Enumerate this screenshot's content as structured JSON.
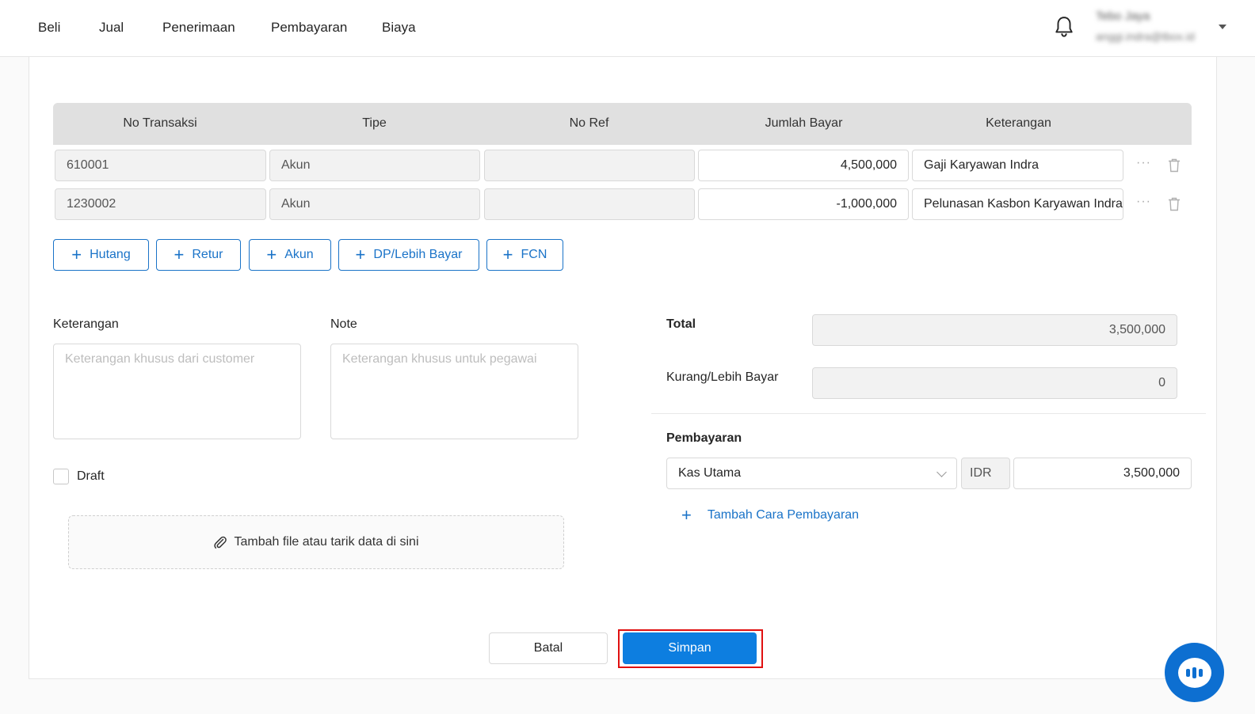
{
  "nav": {
    "items": [
      "Beli",
      "Jual",
      "Penerimaan",
      "Pembayaran",
      "Biaya"
    ],
    "user_name": "Tebo Jaya",
    "user_email": "anggi.indra@tbox.id"
  },
  "table": {
    "headers": [
      "No Transaksi",
      "Tipe",
      "No Ref",
      "Jumlah Bayar",
      "Keterangan"
    ],
    "rows": [
      {
        "no_transaksi": "610001",
        "tipe": "Akun",
        "no_ref": "",
        "jumlah": "4,500,000",
        "keterangan": "Gaji Karyawan Indra",
        "more": "···"
      },
      {
        "no_transaksi": "1230002",
        "tipe": "Akun",
        "no_ref": "",
        "jumlah": "-1,000,000",
        "keterangan": "Pelunasan Kasbon Karyawan Indra",
        "more": "···"
      }
    ]
  },
  "add_buttons": {
    "plus": "+",
    "hutang": "Hutang",
    "retur": "Retur",
    "akun": "Akun",
    "dp": "DP/Lebih Bayar",
    "fcn": "FCN"
  },
  "form": {
    "keterangan_label": "Keterangan",
    "keterangan_placeholder": "Keterangan khusus dari customer",
    "note_label": "Note",
    "note_placeholder": "Keterangan khusus untuk pegawai",
    "draft_label": "Draft",
    "dropzone_text": "Tambah file atau tarik data di sini"
  },
  "summary": {
    "total_label": "Total",
    "total_value": "3,500,000",
    "kurang_label": "Kurang/Lebih Bayar",
    "kurang_value": "0",
    "pembayaran_label": "Pembayaran",
    "account": "Kas Utama",
    "currency": "IDR",
    "amount": "3,500,000",
    "add_payment_label": "Tambah Cara Pembayaran",
    "add_payment_plus": "+"
  },
  "actions": {
    "cancel": "Batal",
    "save": "Simpan"
  },
  "colors": {
    "primary": "#0d7ee0",
    "highlight": "#e01010"
  }
}
